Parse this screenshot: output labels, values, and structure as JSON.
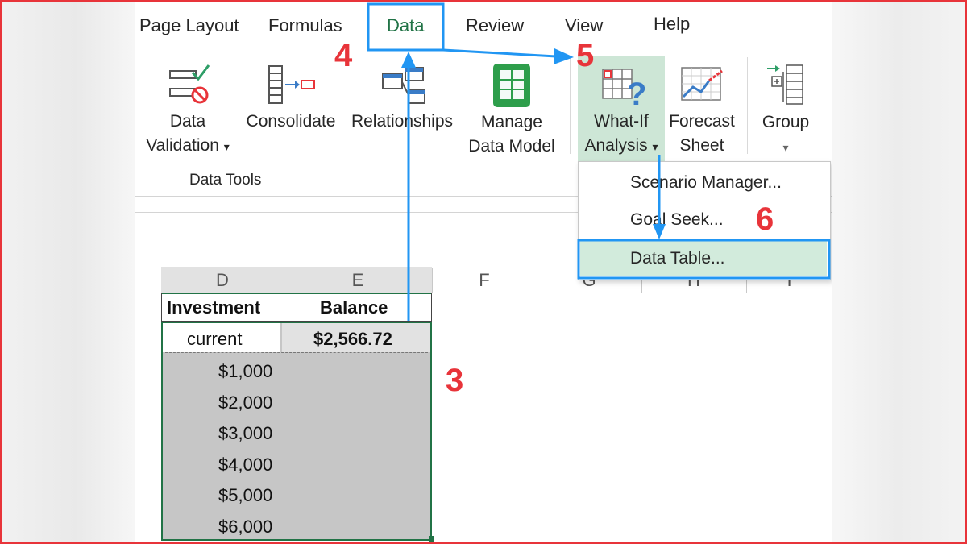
{
  "ribbon": {
    "tabs": [
      {
        "label": "Page Layout"
      },
      {
        "label": "Formulas"
      },
      {
        "label": "Data"
      },
      {
        "label": "Review"
      },
      {
        "label": "View"
      },
      {
        "label": "Help"
      }
    ],
    "active_tab": "Data",
    "commands": {
      "data_validation": {
        "line1": "Data",
        "line2": "Validation",
        "dropdown": "▾"
      },
      "consolidate": {
        "label": "Consolidate"
      },
      "relationships": {
        "label": "Relationships"
      },
      "manage_data_model": {
        "line1": "Manage",
        "line2": "Data Model"
      },
      "what_if_analysis": {
        "line1": "What-If",
        "line2": "Analysis",
        "dropdown": "▾"
      },
      "forecast_sheet": {
        "line1": "Forecast",
        "line2": "Sheet"
      },
      "group": {
        "label": "Group",
        "dropdown": "▾"
      }
    },
    "group_label": "Data Tools"
  },
  "whatif_menu": {
    "items": [
      {
        "label": "Scenario Manager...",
        "underline": "c"
      },
      {
        "label": "Goal Seek...",
        "underline": "a"
      },
      {
        "label": "Data Table...",
        "underline": "T"
      }
    ],
    "highlighted": "Data Table..."
  },
  "sheet": {
    "column_headers": [
      "D",
      "E",
      "F",
      "G",
      "H",
      "I"
    ],
    "header_row": {
      "investment": "Investment",
      "balance": "Balance"
    },
    "current_row": {
      "label": "current",
      "value": "$2,566.72"
    },
    "investments": [
      "$1,000",
      "$2,000",
      "$3,000",
      "$4,000",
      "$5,000",
      "$6,000"
    ]
  },
  "annotations": {
    "steps": [
      "3",
      "4",
      "5",
      "6"
    ],
    "color": "#e8343a",
    "arrow_color": "#2196f3"
  },
  "colors": {
    "excel_green": "#217346",
    "selection_fill": "#c6c6c6",
    "highlight_fill": "#d2ebdc"
  }
}
